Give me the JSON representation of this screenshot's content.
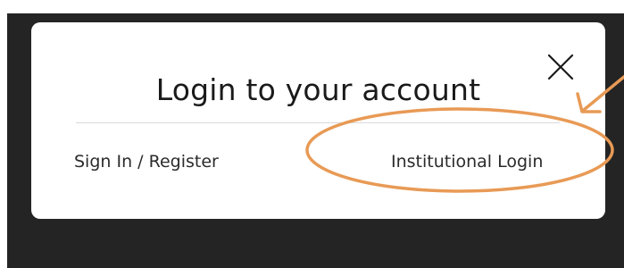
{
  "modal": {
    "title": "Login to your account",
    "close_icon": "close-icon",
    "tabs": [
      {
        "label": "Sign In / Register"
      },
      {
        "label": "Institutional Login"
      }
    ]
  },
  "colors": {
    "backdrop": "#242424",
    "modal_background": "#ffffff",
    "text": "#1a1a1a",
    "divider": "#d9d9d9",
    "annotation": "#e89a55"
  }
}
